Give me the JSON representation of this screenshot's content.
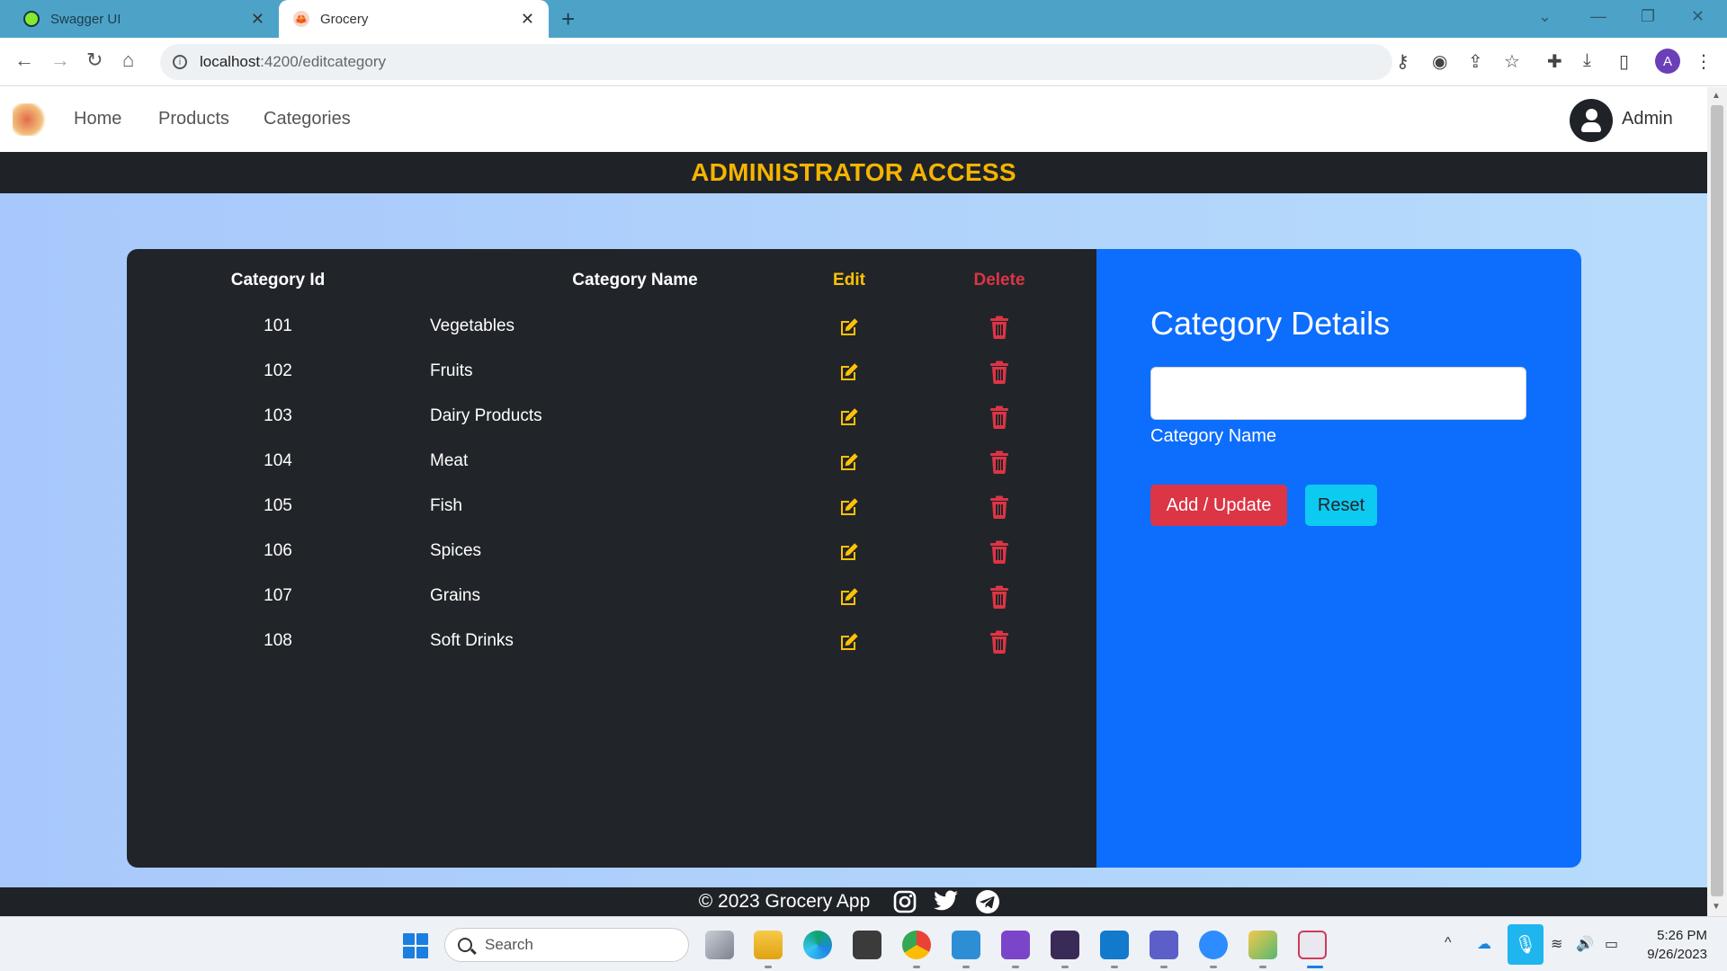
{
  "browser": {
    "tabs": [
      {
        "title": "Swagger UI"
      },
      {
        "title": "Grocery"
      }
    ],
    "new_tab": "+",
    "address": {
      "host": "localhost",
      "path": ":4200/editcategory"
    }
  },
  "nav": {
    "links": [
      "Home",
      "Products",
      "Categories"
    ],
    "user": "Admin"
  },
  "banner": "ADMINISTRATOR ACCESS",
  "table": {
    "headers": {
      "id": "Category Id",
      "name": "Category Name",
      "edit": "Edit",
      "delete": "Delete"
    },
    "rows": [
      {
        "id": "101",
        "name": "Vegetables"
      },
      {
        "id": "102",
        "name": "Fruits"
      },
      {
        "id": "103",
        "name": "Dairy Products"
      },
      {
        "id": "104",
        "name": "Meat"
      },
      {
        "id": "105",
        "name": "Fish"
      },
      {
        "id": "106",
        "name": "Spices"
      },
      {
        "id": "107",
        "name": "Grains"
      },
      {
        "id": "108",
        "name": "Soft Drinks"
      }
    ]
  },
  "form": {
    "title": "Category Details",
    "input_value": "",
    "label": "Category Name",
    "submit": "Add / Update",
    "reset": "Reset"
  },
  "footer": {
    "copyright": "© 2023 Grocery App"
  },
  "taskbar": {
    "search": "Search",
    "time": "5:26 PM",
    "date": "9/26/2023"
  },
  "colors": {
    "banner_text": "#f5b400",
    "edit": "#ffc107",
    "delete": "#dc3545",
    "panel_dark": "#212529",
    "panel_blue": "#0d6efd"
  }
}
